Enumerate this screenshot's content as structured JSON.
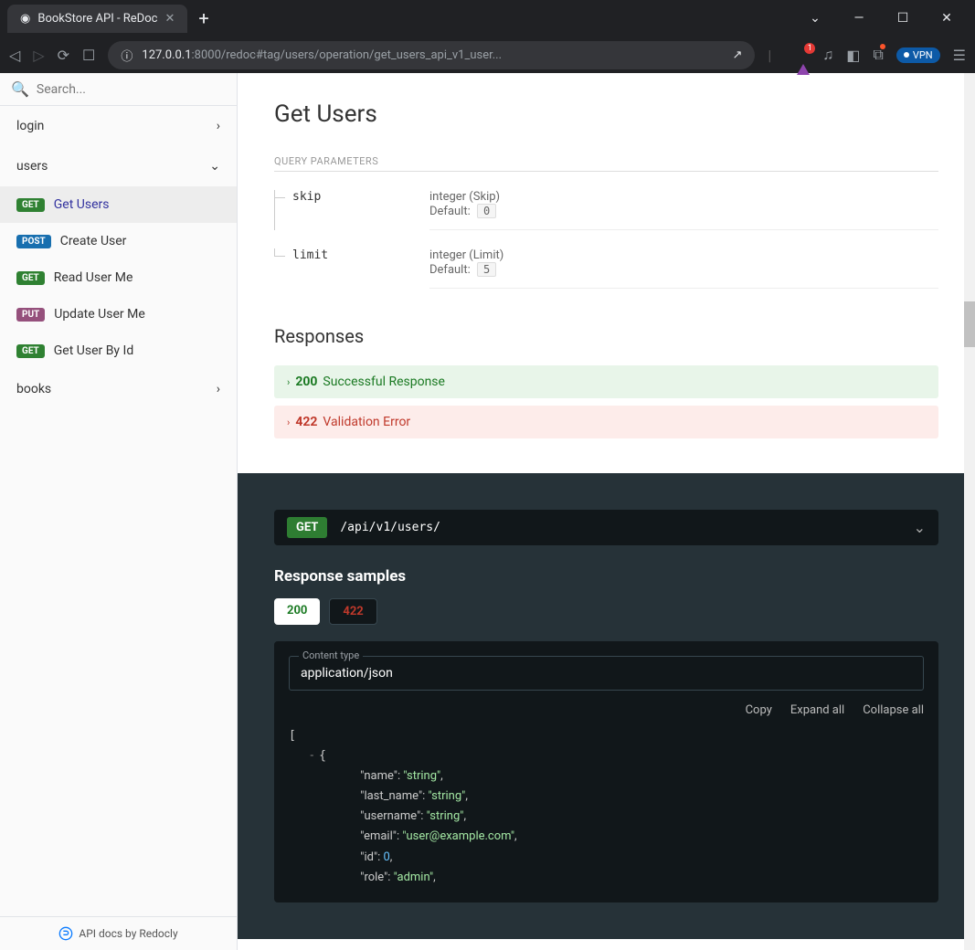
{
  "browser": {
    "tab_title": "BookStore API - ReDoc",
    "url_host": "127.0.0.1",
    "url_port_path": ":8000/redoc#tag/users/operation/get_users_api_v1_user...",
    "badge_count": "1",
    "vpn_label": "VPN"
  },
  "sidebar": {
    "search_placeholder": "Search...",
    "sections": [
      {
        "label": "login",
        "expanded": false
      },
      {
        "label": "users",
        "expanded": true
      },
      {
        "label": "books",
        "expanded": false
      }
    ],
    "items": [
      {
        "method": "GET",
        "method_class": "m-get",
        "label": "Get Users",
        "active": true
      },
      {
        "method": "POST",
        "method_class": "m-post",
        "label": "Create User"
      },
      {
        "method": "GET",
        "method_class": "m-get",
        "label": "Read User Me"
      },
      {
        "method": "PUT",
        "method_class": "m-put",
        "label": "Update User Me"
      },
      {
        "method": "GET",
        "method_class": "m-get",
        "label": "Get User By Id"
      }
    ],
    "footer": "API docs by Redocly"
  },
  "main": {
    "title": "Get Users",
    "query_params_label": "QUERY PARAMETERS",
    "params": [
      {
        "name": "skip",
        "type": "integer (Skip)",
        "default_label": "Default:",
        "default": "0"
      },
      {
        "name": "limit",
        "type": "integer (Limit)",
        "default_label": "Default:",
        "default": "5"
      }
    ],
    "responses_title": "Responses",
    "responses": [
      {
        "code": "200",
        "label": "Successful Response",
        "ok": true
      },
      {
        "code": "422",
        "label": "Validation Error",
        "ok": false
      }
    ]
  },
  "dark": {
    "method": "GET",
    "path": "/api/v1/users/",
    "samples_title": "Response samples",
    "tabs": [
      {
        "label": "200",
        "cls": "t-200"
      },
      {
        "label": "422",
        "cls": "t-422"
      }
    ],
    "content_type_label": "Content type",
    "content_type": "application/json",
    "actions": {
      "copy": "Copy",
      "expand": "Expand all",
      "collapse": "Collapse all"
    },
    "json_sample": {
      "open_bracket": "[",
      "open_brace": "{",
      "fields": [
        {
          "key": "\"name\"",
          "val": "\"string\"",
          "cls": "tok-s",
          "comma": ","
        },
        {
          "key": "\"last_name\"",
          "val": "\"string\"",
          "cls": "tok-s",
          "comma": ","
        },
        {
          "key": "\"username\"",
          "val": "\"string\"",
          "cls": "tok-s",
          "comma": ","
        },
        {
          "key": "\"email\"",
          "val": "\"user@example.com\"",
          "cls": "tok-s",
          "comma": ","
        },
        {
          "key": "\"id\"",
          "val": "0",
          "cls": "tok-n",
          "comma": ","
        },
        {
          "key": "\"role\"",
          "val": "\"admin\"",
          "cls": "tok-s",
          "comma": ","
        }
      ]
    }
  }
}
